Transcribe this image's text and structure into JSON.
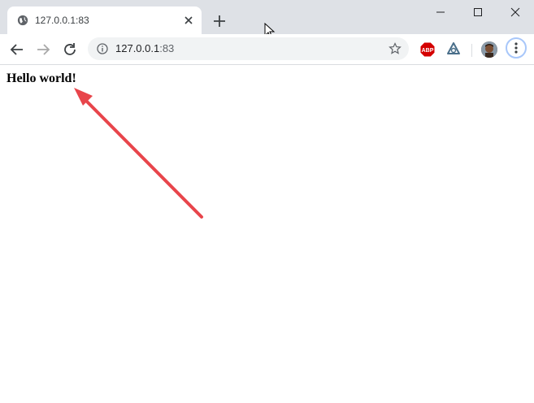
{
  "tab": {
    "title": "127.0.0.1:83",
    "favicon": "globe-icon"
  },
  "address_bar": {
    "host": "127.0.0.1",
    "port": ":83"
  },
  "extensions": [
    {
      "name": "adblock-plus-icon",
      "label": "ABP"
    },
    {
      "name": "extension-icon"
    }
  ],
  "page": {
    "heading": "Hello world!"
  },
  "annotation": {
    "type": "arrow",
    "color": "#e8454b"
  },
  "colors": {
    "tabstrip": "#dee1e6",
    "omnibox": "#f1f3f4",
    "abp_red": "#d40000"
  }
}
